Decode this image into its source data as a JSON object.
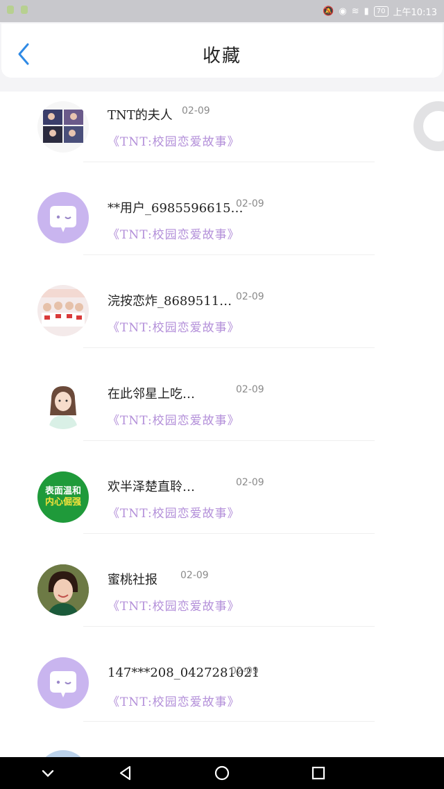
{
  "status_bar": {
    "battery": "70",
    "time": "上午10:13"
  },
  "header": {
    "title": "收藏"
  },
  "items": [
    {
      "name": "TNT的夫人",
      "date": "02-09",
      "work": "《TNT:校园恋爱故事》",
      "avatar": "photo-group"
    },
    {
      "name": "**用户_6985596615…",
      "date": "02-09",
      "work": "《TNT:校园恋爱故事》",
      "avatar": "default-chat"
    },
    {
      "name": "浣按恋炸_8689511…",
      "date": "02-09",
      "work": "《TNT:校园恋爱故事》",
      "avatar": "photo-group-red"
    },
    {
      "name": "在此邻星上吃…",
      "date": "02-09",
      "work": "《TNT:校园恋爱故事》",
      "avatar": "illustration-girl"
    },
    {
      "name": "欢半泽楚直聆…",
      "date": "02-09",
      "work": "《TNT:校园恋爱故事》",
      "avatar": "green-text",
      "avatar_text": [
        "表面温和",
        "内心倔强"
      ]
    },
    {
      "name": "蜜桃社报",
      "date": "02-09",
      "work": "《TNT:校园恋爱故事》",
      "avatar": "photo-girl"
    },
    {
      "name": "147***208_0427281021",
      "date": "02-09",
      "work": "《TNT:校园恋爱故事》",
      "avatar": "default-chat"
    }
  ],
  "colors": {
    "accent": "#2f8ae5",
    "work_title": "#b38fd9",
    "default_avatar": "#c9b5ef"
  }
}
